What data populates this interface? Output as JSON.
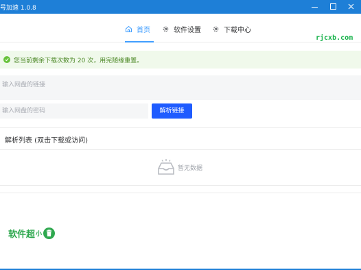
{
  "window": {
    "title": "号加速 1.0.8"
  },
  "nav": {
    "items": [
      {
        "label": "首页",
        "icon": "home-icon",
        "active": true
      },
      {
        "label": "软件设置",
        "icon": "gear-icon",
        "active": false
      },
      {
        "label": "下载中心",
        "icon": "gear-icon",
        "active": false
      }
    ]
  },
  "watermark_top": "rjcxb.com",
  "alert": {
    "text": "您当前剩余下载次数为 20 次，用完随缘重置。",
    "icon": "success-check-icon",
    "color": "#67c23a"
  },
  "link_input": {
    "placeholder": "输入网盘的链接"
  },
  "password_input": {
    "placeholder": "输入网盘的密码"
  },
  "parse_button": {
    "label": "解析链接",
    "color": "#1f5cff"
  },
  "result_list": {
    "header": "解析列表 (双击下载或访问)",
    "empty_text": "暂无数据",
    "empty_icon": "empty-inbox-icon"
  },
  "watermark_bottom": {
    "text": "软件超",
    "small": "小",
    "badge_icon": "trash-badge-icon"
  },
  "colors": {
    "titlebar": "#1e7fd7",
    "accent": "#409eff"
  }
}
